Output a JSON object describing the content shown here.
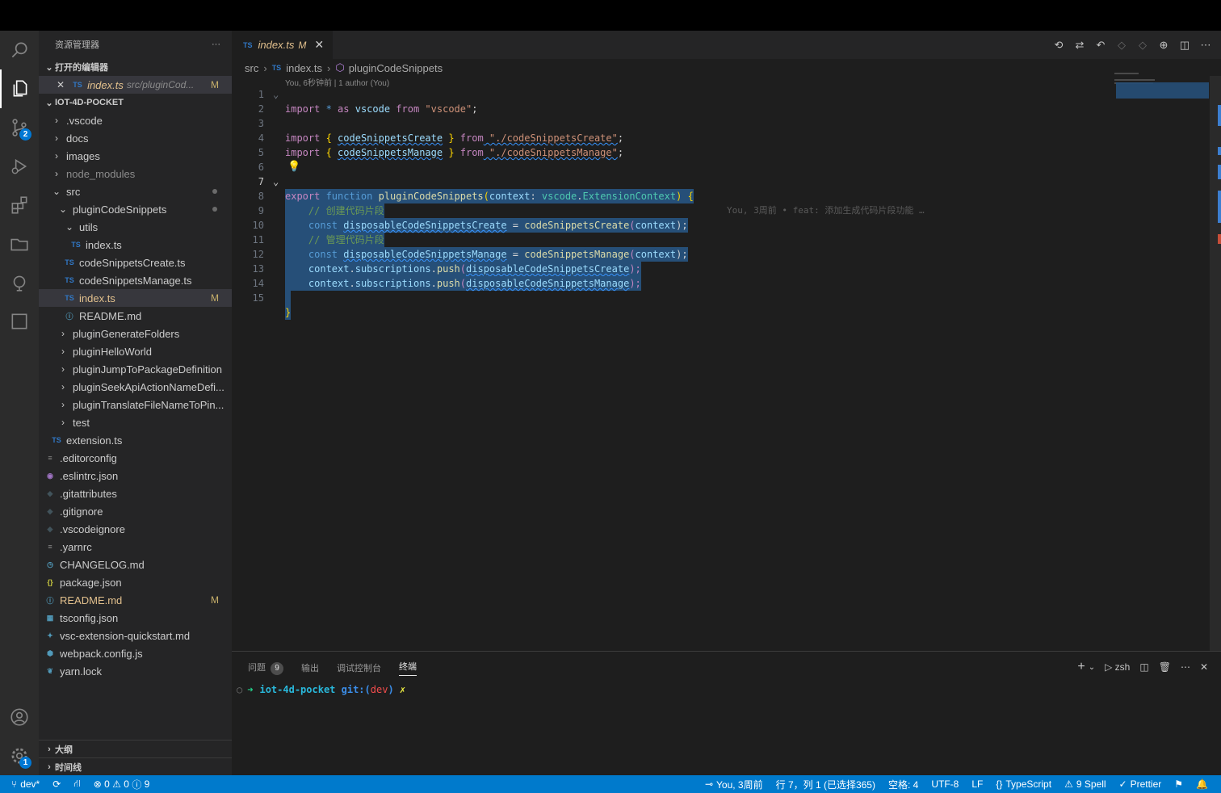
{
  "explorer": {
    "title": "资源管理器",
    "more": "···",
    "open_editors_header": "打开的编辑器",
    "open_editor": {
      "name": "index.ts",
      "path": "src/pluginCod...",
      "status": "M",
      "type_icon": "TS"
    },
    "project_header": "IOT-4D-POCKET",
    "tree": [
      {
        "label": ".vscode",
        "kind": "folder"
      },
      {
        "label": "docs",
        "kind": "folder"
      },
      {
        "label": "images",
        "kind": "folder"
      },
      {
        "label": "node_modules",
        "kind": "folder"
      },
      {
        "label": "src",
        "kind": "folder-open"
      },
      {
        "label": "pluginCodeSnippets",
        "kind": "folder-open"
      },
      {
        "label": "utils",
        "kind": "folder-open"
      },
      {
        "label": "index.ts",
        "kind": "ts"
      },
      {
        "label": "codeSnippetsCreate.ts",
        "kind": "ts"
      },
      {
        "label": "codeSnippetsManage.ts",
        "kind": "ts"
      },
      {
        "label": "index.ts",
        "kind": "ts",
        "status": "M"
      },
      {
        "label": "README.md",
        "kind": "info"
      },
      {
        "label": "pluginGenerateFolders",
        "kind": "folder"
      },
      {
        "label": "pluginHelloWorld",
        "kind": "folder"
      },
      {
        "label": "pluginJumpToPackageDefinition",
        "kind": "folder"
      },
      {
        "label": "pluginSeekApiActionNameDefi...",
        "kind": "folder"
      },
      {
        "label": "pluginTranslateFileNameToPin...",
        "kind": "folder"
      },
      {
        "label": "test",
        "kind": "folder"
      },
      {
        "label": "extension.ts",
        "kind": "ts"
      },
      {
        "label": ".editorconfig",
        "kind": "lines"
      },
      {
        "label": ".eslintrc.json",
        "kind": "eslint"
      },
      {
        "label": ".gitattributes",
        "kind": "git"
      },
      {
        "label": ".gitignore",
        "kind": "git"
      },
      {
        "label": ".vscodeignore",
        "kind": "git"
      },
      {
        "label": ".yarnrc",
        "kind": "lines"
      },
      {
        "label": "CHANGELOG.md",
        "kind": "clock"
      },
      {
        "label": "package.json",
        "kind": "json"
      },
      {
        "label": "README.md",
        "kind": "info",
        "status": "M"
      },
      {
        "label": "tsconfig.json",
        "kind": "tsconfig"
      },
      {
        "label": "vsc-extension-quickstart.md",
        "kind": "pin"
      },
      {
        "label": "webpack.config.js",
        "kind": "webpack"
      },
      {
        "label": "yarn.lock",
        "kind": "yarn"
      }
    ],
    "outline_header": "大纲",
    "timeline_header": "时间线"
  },
  "activity": {
    "scm_badge": "2",
    "settings_badge": "1"
  },
  "tab": {
    "icon": "TS",
    "name": "index.ts",
    "status": "M",
    "close": "✕"
  },
  "breadcrumb": {
    "p1": "src",
    "p2_icon": "TS",
    "p2": "index.ts",
    "p3": "pluginCodeSnippets"
  },
  "codelens": "You, 6秒钟前 | 1 author (You)",
  "code": {
    "line_numbers": [
      "1",
      "2",
      "3",
      "4",
      "5",
      "6",
      "7",
      "8",
      "9",
      "10",
      "11",
      "12",
      "13",
      "14",
      "15"
    ],
    "l1": {
      "kw": "import",
      "star": " * ",
      "as": "as",
      "name": " vscode ",
      "from": "from",
      "str": " \"vscode\"",
      "end": ";"
    },
    "l3": {
      "kw": "import",
      "open": " { ",
      "name": "codeSnippetsCreate",
      "close": " } ",
      "from": "from",
      "str": " \"./codeSnippetsCreate\"",
      "end": ";"
    },
    "l4": {
      "kw": "import",
      "open": " { ",
      "name": "codeSnippetsManage",
      "close": " } ",
      "from": "from",
      "str": " \"./codeSnippetsManage\"",
      "end": ";"
    },
    "l7": {
      "export": "export",
      "function": " function ",
      "fn": "pluginCodeSnippets",
      "p1": "(",
      "param": "context",
      "colon": ": ",
      "ns": "vscode",
      "dot": ".",
      "type": "ExtensionContext",
      "p2": ") ",
      "brace": "{"
    },
    "l7_blame": "You, 3周前 • feat: 添加生成代码片段功能 …",
    "l8": "// 创建代码片段",
    "l9": {
      "const": "const ",
      "var": "disposableCodeSnippetsCreate",
      "eq": " = ",
      "fn": "codeSnippetsCreate",
      "p1": "(",
      "arg": "context",
      "p2": ");"
    },
    "l10": "// 管理代码片段",
    "l11": {
      "const": "const ",
      "var": "disposableCodeSnippetsManage",
      "eq": " = ",
      "fn": "codeSnippetsManage",
      "p1": "(",
      "arg": "context",
      "p2": ");"
    },
    "l12": {
      "obj": "context",
      "dot": ".",
      "prop": "subscriptions",
      "dot2": ".",
      "fn": "push",
      "p1": "(",
      "arg": "disposableCodeSnippetsCreate",
      "p2": ");"
    },
    "l13": {
      "obj": "context",
      "dot": ".",
      "prop": "subscriptions",
      "dot2": ".",
      "fn": "push",
      "p1": "(",
      "arg": "disposableCodeSnippetsManage",
      "p2": ");"
    },
    "l15": "}"
  },
  "panel": {
    "tab_problems": "问题",
    "problems_count": "9",
    "tab_output": "输出",
    "tab_debug": "调试控制台",
    "tab_terminal": "终端",
    "shell": "zsh",
    "prompt_dir": "iot-4d-pocket",
    "prompt_git": "git:(",
    "prompt_branch": "dev",
    "prompt_git_close": ")",
    "prompt_dirty": "✗"
  },
  "status": {
    "branch": "dev*",
    "errors": "0",
    "warnings": "0",
    "infos": "9",
    "blame": "You, 3周前",
    "cursor": "行 7，列 1 (已选择365)",
    "spaces": "空格: 4",
    "encoding": "UTF-8",
    "eol": "LF",
    "language": "TypeScript",
    "spell": "9 Spell",
    "prettier": "Prettier"
  }
}
